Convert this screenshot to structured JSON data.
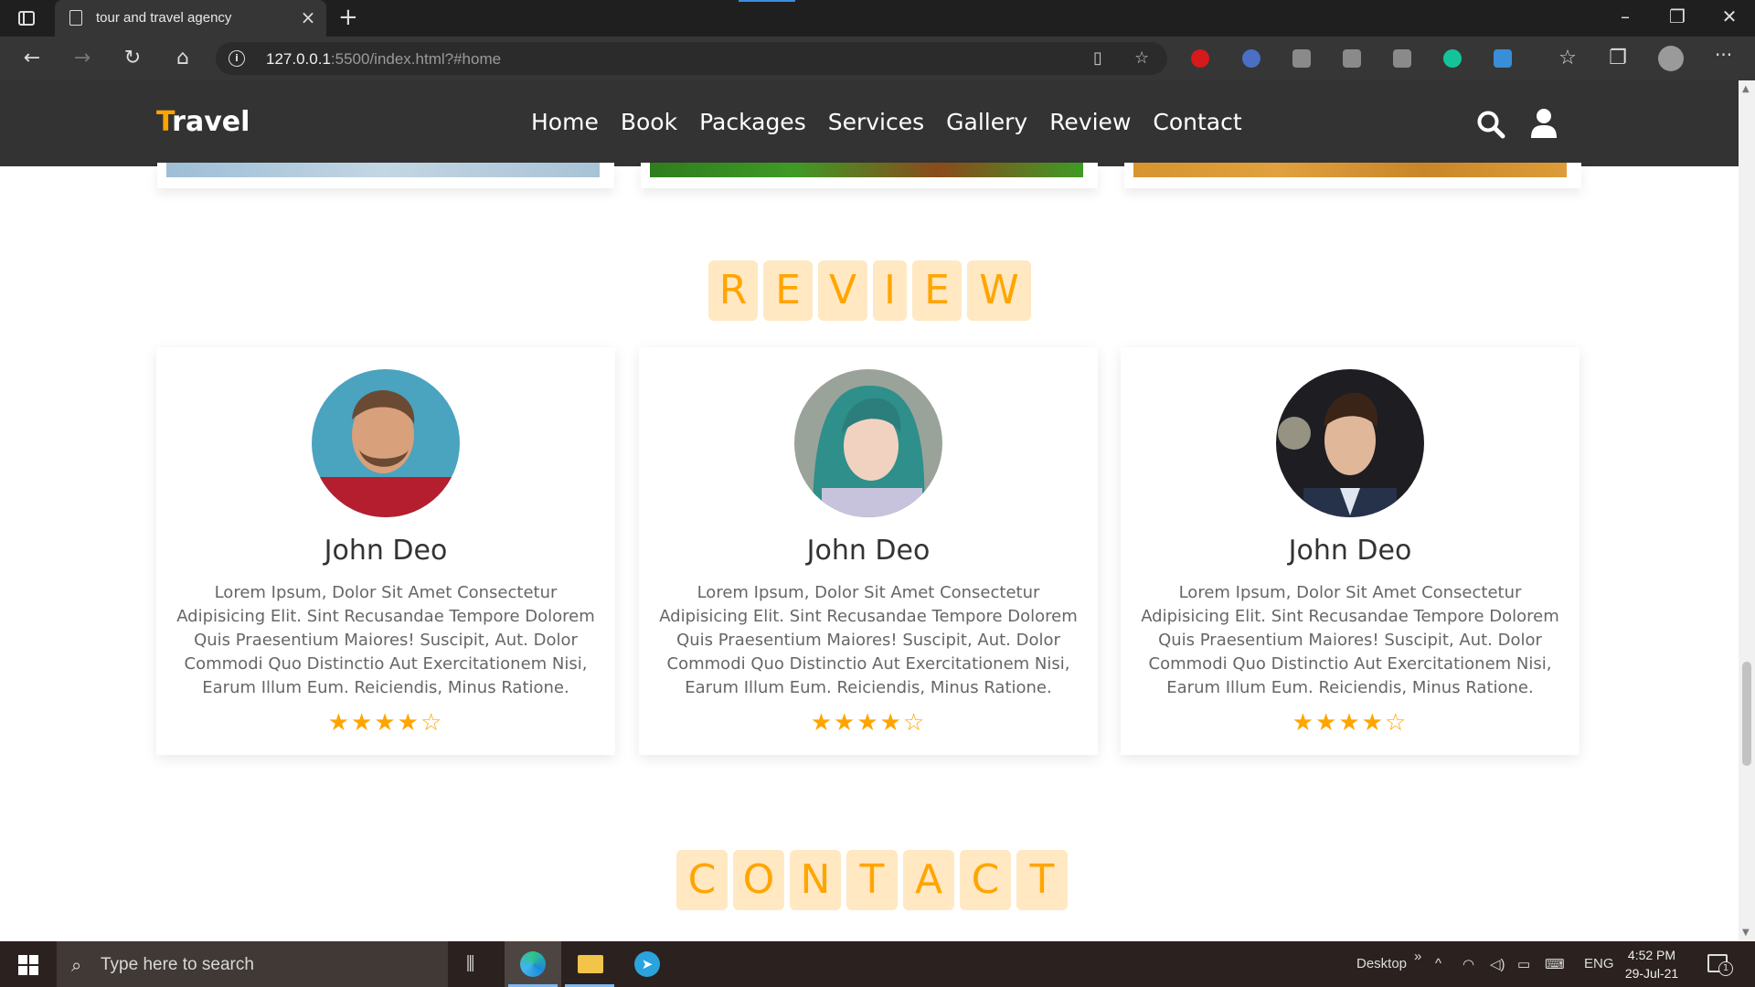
{
  "browser": {
    "tab_title": "tour and travel agency",
    "tab_close": "×",
    "new_tab": "+",
    "url_host": "127.0.0.1",
    "url_path": ":5500/index.html?#home",
    "window_controls": [
      "–",
      "❐",
      "✕"
    ]
  },
  "header": {
    "logo_first": "T",
    "logo_rest": "ravel",
    "nav": [
      "Home",
      "Book",
      "Packages",
      "Services",
      "Gallery",
      "Review",
      "Contact"
    ],
    "accent_color": "#ffa500",
    "icons": [
      "search-icon",
      "user-icon"
    ]
  },
  "review_section": {
    "heading_letters": [
      "R",
      "E",
      "V",
      "I",
      "E",
      "W"
    ],
    "reviews": [
      {
        "name": "John Deo",
        "text": "Lorem Ipsum, Dolor Sit Amet Consectetur Adipisicing Elit. Sint Recusandae Tempore Dolorem Quis Praesentium Maiores! Suscipit, Aut. Dolor Commodi Quo Distinctio Aut Exercitationem Nisi, Earum Illum Eum. Reiciendis, Minus Ratione.",
        "rating": 4,
        "max_rating": 5
      },
      {
        "name": "John Deo",
        "text": "Lorem Ipsum, Dolor Sit Amet Consectetur Adipisicing Elit. Sint Recusandae Tempore Dolorem Quis Praesentium Maiores! Suscipit, Aut. Dolor Commodi Quo Distinctio Aut Exercitationem Nisi, Earum Illum Eum. Reiciendis, Minus Ratione.",
        "rating": 4,
        "max_rating": 5
      },
      {
        "name": "John Deo",
        "text": "Lorem Ipsum, Dolor Sit Amet Consectetur Adipisicing Elit. Sint Recusandae Tempore Dolorem Quis Praesentium Maiores! Suscipit, Aut. Dolor Commodi Quo Distinctio Aut Exercitationem Nisi, Earum Illum Eum. Reiciendis, Minus Ratione.",
        "rating": 4,
        "max_rating": 5
      }
    ]
  },
  "contact_section": {
    "heading_letters": [
      "C",
      "O",
      "N",
      "T",
      "A",
      "C",
      "T"
    ]
  },
  "taskbar": {
    "search_placeholder": "Type here to search",
    "desktop_label": "Desktop",
    "language": "ENG",
    "time": "4:52 PM",
    "date": "29-Jul-21",
    "notification_count": "1"
  }
}
